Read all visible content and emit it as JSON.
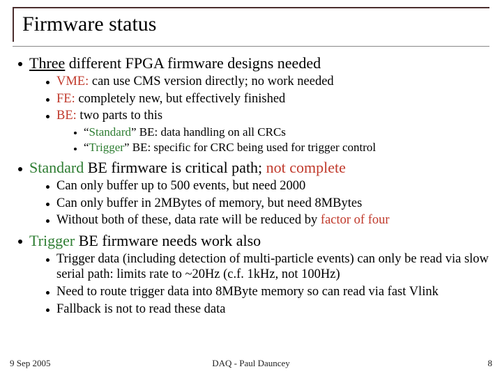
{
  "title": "Firmware status",
  "b1": {
    "heading_pre": "Three",
    "heading_post": " different FPGA firmware designs needed",
    "s1_a": "VME:",
    "s1_b": " can use CMS version directly; no work needed",
    "s2_a": "FE:",
    "s2_b": " completely new, but effectively finished",
    "s3_a": "BE:",
    "s3_b": " two parts to this",
    "ss1_a": "“",
    "ss1_b": "Standard",
    "ss1_c": "” BE: data handling on all CRCs",
    "ss2_a": "“",
    "ss2_b": "Trigger",
    "ss2_c": "” BE: specific for CRC being used for trigger control"
  },
  "b2": {
    "heading_a": "Standard",
    "heading_b": " BE firmware is critical path; ",
    "heading_c": "not complete",
    "s1": "Can only buffer up to 500 events, but need 2000",
    "s2": "Can only buffer in 2MBytes of memory, but need 8MBytes",
    "s3_a": "Without both of these, data rate will be reduced by ",
    "s3_b": "factor of four"
  },
  "b3": {
    "heading_a": "Trigger",
    "heading_b": " BE firmware needs work also",
    "s1": "Trigger data (including detection of multi-particle events) can only be read via slow serial path: limits rate to ~20Hz (c.f. 1kHz, not 100Hz)",
    "s2": "Need to route trigger data into 8MByte memory so can read via fast Vlink",
    "s3": "Fallback is not to read these data"
  },
  "footer": {
    "date": "9 Sep 2005",
    "center": "DAQ - Paul Dauncey",
    "page": "8"
  }
}
